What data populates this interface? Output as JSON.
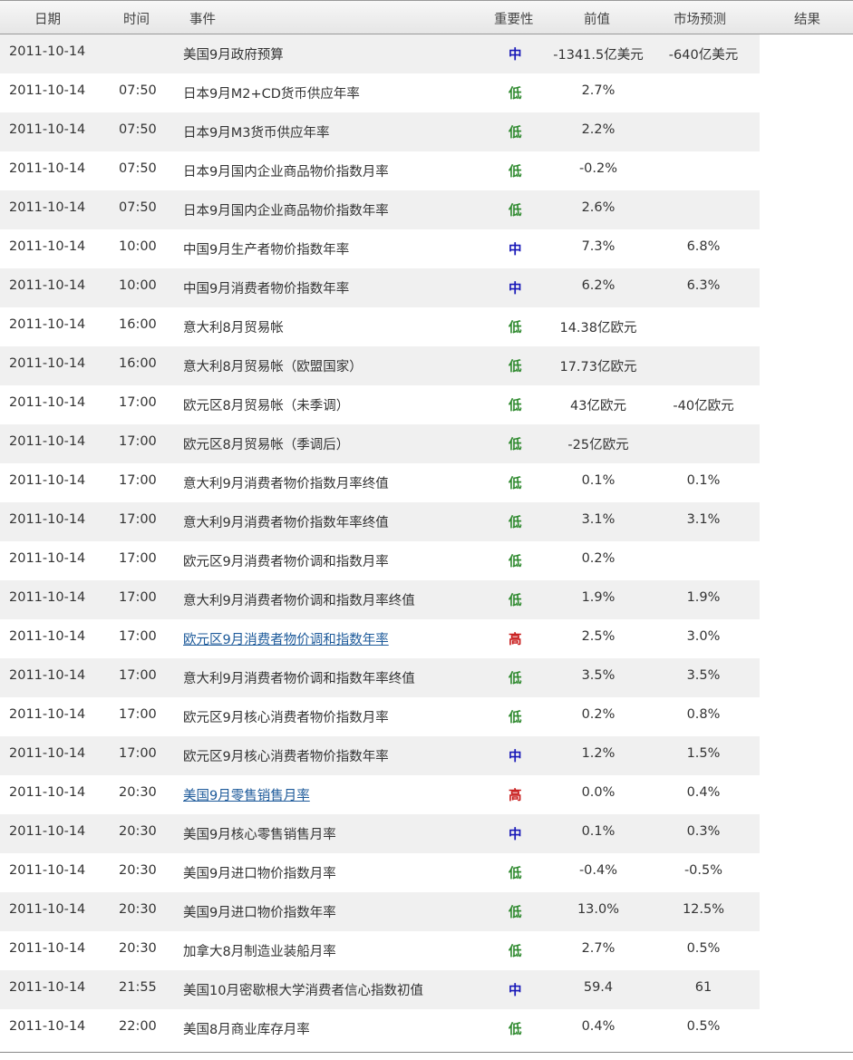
{
  "header": {
    "date": "日期",
    "time": "时间",
    "event": "事件",
    "importance": "重要性",
    "previous": "前值",
    "forecast": "市场预测",
    "result": "结果"
  },
  "rows": [
    {
      "date": "2011-10-14",
      "time": "",
      "event": "美国9月政府预算",
      "importance": "中",
      "previous": "-1341.5亿美元",
      "forecast": "-640亿美元",
      "link": false
    },
    {
      "date": "2011-10-14",
      "time": "07:50",
      "event": "日本9月M2+CD货币供应年率",
      "importance": "低",
      "previous": "2.7%",
      "forecast": "",
      "link": false
    },
    {
      "date": "2011-10-14",
      "time": "07:50",
      "event": "日本9月M3货币供应年率",
      "importance": "低",
      "previous": "2.2%",
      "forecast": "",
      "link": false
    },
    {
      "date": "2011-10-14",
      "time": "07:50",
      "event": "日本9月国内企业商品物价指数月率",
      "importance": "低",
      "previous": "-0.2%",
      "forecast": "",
      "link": false
    },
    {
      "date": "2011-10-14",
      "time": "07:50",
      "event": "日本9月国内企业商品物价指数年率",
      "importance": "低",
      "previous": "2.6%",
      "forecast": "",
      "link": false
    },
    {
      "date": "2011-10-14",
      "time": "10:00",
      "event": "中国9月生产者物价指数年率",
      "importance": "中",
      "previous": "7.3%",
      "forecast": "6.8%",
      "link": false
    },
    {
      "date": "2011-10-14",
      "time": "10:00",
      "event": "中国9月消费者物价指数年率",
      "importance": "中",
      "previous": "6.2%",
      "forecast": "6.3%",
      "link": false
    },
    {
      "date": "2011-10-14",
      "time": "16:00",
      "event": "意大利8月贸易帐",
      "importance": "低",
      "previous": "14.38亿欧元",
      "forecast": "",
      "link": false
    },
    {
      "date": "2011-10-14",
      "time": "16:00",
      "event": "意大利8月贸易帐（欧盟国家）",
      "importance": "低",
      "previous": "17.73亿欧元",
      "forecast": "",
      "link": false
    },
    {
      "date": "2011-10-14",
      "time": "17:00",
      "event": "欧元区8月贸易帐（未季调）",
      "importance": "低",
      "previous": "43亿欧元",
      "forecast": "-40亿欧元",
      "link": false
    },
    {
      "date": "2011-10-14",
      "time": "17:00",
      "event": "欧元区8月贸易帐（季调后）",
      "importance": "低",
      "previous": "-25亿欧元",
      "forecast": "",
      "link": false
    },
    {
      "date": "2011-10-14",
      "time": "17:00",
      "event": "意大利9月消费者物价指数月率终值",
      "importance": "低",
      "previous": "0.1%",
      "forecast": "0.1%",
      "link": false
    },
    {
      "date": "2011-10-14",
      "time": "17:00",
      "event": "意大利9月消费者物价指数年率终值",
      "importance": "低",
      "previous": "3.1%",
      "forecast": "3.1%",
      "link": false
    },
    {
      "date": "2011-10-14",
      "time": "17:00",
      "event": "欧元区9月消费者物价调和指数月率",
      "importance": "低",
      "previous": "0.2%",
      "forecast": "",
      "link": false
    },
    {
      "date": "2011-10-14",
      "time": "17:00",
      "event": "意大利9月消费者物价调和指数月率终值",
      "importance": "低",
      "previous": "1.9%",
      "forecast": "1.9%",
      "link": false
    },
    {
      "date": "2011-10-14",
      "time": "17:00",
      "event": "欧元区9月消费者物价调和指数年率",
      "importance": "高",
      "previous": "2.5%",
      "forecast": "3.0%",
      "link": true
    },
    {
      "date": "2011-10-14",
      "time": "17:00",
      "event": "意大利9月消费者物价调和指数年率终值",
      "importance": "低",
      "previous": "3.5%",
      "forecast": "3.5%",
      "link": false
    },
    {
      "date": "2011-10-14",
      "time": "17:00",
      "event": "欧元区9月核心消费者物价指数月率",
      "importance": "低",
      "previous": "0.2%",
      "forecast": "0.8%",
      "link": false
    },
    {
      "date": "2011-10-14",
      "time": "17:00",
      "event": "欧元区9月核心消费者物价指数年率",
      "importance": "中",
      "previous": "1.2%",
      "forecast": "1.5%",
      "link": false
    },
    {
      "date": "2011-10-14",
      "time": "20:30",
      "event": "美国9月零售销售月率",
      "importance": "高",
      "previous": "0.0%",
      "forecast": "0.4%",
      "link": true
    },
    {
      "date": "2011-10-14",
      "time": "20:30",
      "event": "美国9月核心零售销售月率",
      "importance": "中",
      "previous": "0.1%",
      "forecast": "0.3%",
      "link": false
    },
    {
      "date": "2011-10-14",
      "time": "20:30",
      "event": "美国9月进口物价指数月率",
      "importance": "低",
      "previous": "-0.4%",
      "forecast": "-0.5%",
      "link": false
    },
    {
      "date": "2011-10-14",
      "time": "20:30",
      "event": "美国9月进口物价指数年率",
      "importance": "低",
      "previous": "13.0%",
      "forecast": "12.5%",
      "link": false
    },
    {
      "date": "2011-10-14",
      "time": "20:30",
      "event": "加拿大8月制造业装船月率",
      "importance": "低",
      "previous": "2.7%",
      "forecast": "0.5%",
      "link": false
    },
    {
      "date": "2011-10-14",
      "time": "21:55",
      "event": "美国10月密歇根大学消费者信心指数初值",
      "importance": "中",
      "previous": "59.4",
      "forecast": "61",
      "link": false
    },
    {
      "date": "2011-10-14",
      "time": "22:00",
      "event": "美国8月商业库存月率",
      "importance": "低",
      "previous": "0.4%",
      "forecast": "0.5%",
      "link": false
    }
  ],
  "colors": {
    "importance_low": "#2f8a2f",
    "importance_mid": "#1818b8",
    "importance_high": "#c81a1a",
    "link": "#1d5a9a",
    "row_stripe": "#f0f0f0"
  }
}
